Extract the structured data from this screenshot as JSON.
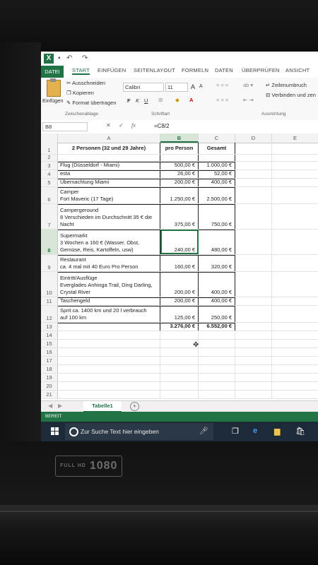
{
  "ribbon": {
    "tabs": [
      "DATEI",
      "START",
      "EINFÜGEN",
      "SEITENLAYOUT",
      "FORMELN",
      "DATEN",
      "ÜBERPRÜFEN",
      "ANSICHT"
    ],
    "cut": "Ausschneiden",
    "copy": "Kopieren",
    "format_painter": "Format übertragen",
    "paste": "Einfügen",
    "clipboard_group": "Zwischenablage",
    "font_name": "Calibri",
    "font_size": "11",
    "grow": "A",
    "shrink": "A",
    "bold": "F",
    "italic": "K",
    "underline": "U",
    "font_group": "Schriftart",
    "wrap_text": "Zeilenumbruch",
    "merge": "Verbinden und zen",
    "align_group": "Ausrichtung"
  },
  "formula_bar": {
    "name_box": "B8",
    "fx": "fx",
    "formula": "=C8/2"
  },
  "columns": [
    "A",
    "B",
    "C",
    "D",
    "E"
  ],
  "rows": [
    {
      "n": "1",
      "a": "2 Personen (32 und 29 Jahre)",
      "b": "pro Person",
      "c": "Gesamt"
    },
    {
      "n": "2",
      "a": "",
      "b": "",
      "c": ""
    },
    {
      "n": "3",
      "a": "Flug (Düsseldorf - Miami)",
      "b": "500,00 €",
      "c": "1.000,00 €"
    },
    {
      "n": "4",
      "a": "esta",
      "b": "26,00 €",
      "c": "52,00 €"
    },
    {
      "n": "5",
      "a": "Übernachtung Miami",
      "b": "200,00 €",
      "c": "400,00 €"
    },
    {
      "n": "6",
      "a": "Camper\nFort Maveric (17 Tage)",
      "b": "1.250,00 €",
      "c": "2.500,00 €"
    },
    {
      "n": "7",
      "a": "Campergeround\n8 Verschieden im Durchschnitt 35 € die\nNacht",
      "b": "375,00 €",
      "c": "750,00 €"
    },
    {
      "n": "8",
      "a": "Supermarkt\n3 Wochen a 160 € (Wasser, Obst,\nGemüse, Reis, Kartoffeln, usw)",
      "b": "240,00 €",
      "c": "480,00 €"
    },
    {
      "n": "9",
      "a": "Restaurant\nca. 4 mal mit 40  Euro Pro Person",
      "b": "160,00 €",
      "c": "320,00 €"
    },
    {
      "n": "10",
      "a": "Eintritt/Ausflüge\nEverglades Anhinga Trail, Ding Darling,\nCrystal River",
      "b": "200,00 €",
      "c": "400,00 €"
    },
    {
      "n": "11",
      "a": "Taschengeld",
      "b": "200,00 €",
      "c": "400,00 €"
    },
    {
      "n": "12",
      "a": "Sprit ca. 1400 km und 20 l verbrauch\nauf 100 km",
      "b": "125,00 €",
      "c": "250,00 €"
    },
    {
      "n": "13",
      "a": "",
      "b": "3.276,00 €",
      "c": "6.552,00 €"
    },
    {
      "n": "14",
      "a": "",
      "b": "",
      "c": ""
    },
    {
      "n": "15",
      "a": "",
      "b": "",
      "c": ""
    },
    {
      "n": "16",
      "a": "",
      "b": "",
      "c": ""
    },
    {
      "n": "17",
      "a": "",
      "b": "",
      "c": ""
    },
    {
      "n": "18",
      "a": "",
      "b": "",
      "c": ""
    },
    {
      "n": "19",
      "a": "",
      "b": "",
      "c": ""
    },
    {
      "n": "20",
      "a": "",
      "b": "",
      "c": ""
    },
    {
      "n": "21",
      "a": "",
      "b": "",
      "c": ""
    }
  ],
  "sheet_tab": "Tabelle1",
  "status": "BEREIT",
  "taskbar": {
    "search_placeholder": "Zur Suche Text hier eingeben"
  },
  "monitor_logo": {
    "small": "FULL HD",
    "big": "1080"
  },
  "colors": {
    "excel_green": "#217346",
    "taskbar": "#1d2a38"
  }
}
